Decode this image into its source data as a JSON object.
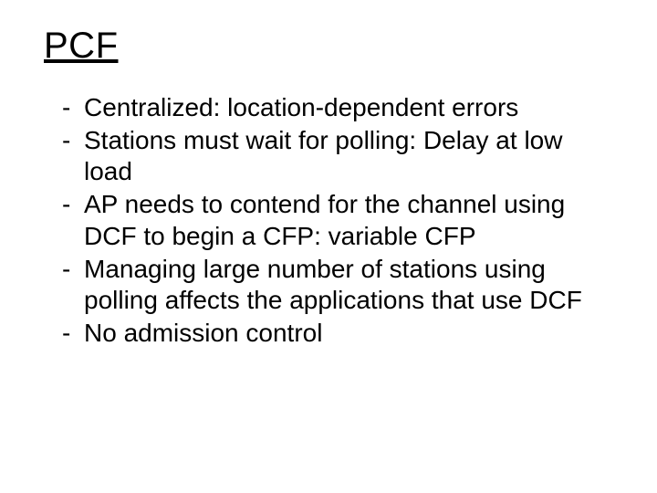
{
  "title": "PCF",
  "bullets": [
    "Centralized: location-dependent errors",
    "Stations must wait for polling: Delay at low load",
    "AP needs to contend for the channel using DCF to begin a CFP: variable CFP",
    "Managing large number of stations using polling affects the applications that use DCF",
    "No admission control"
  ]
}
